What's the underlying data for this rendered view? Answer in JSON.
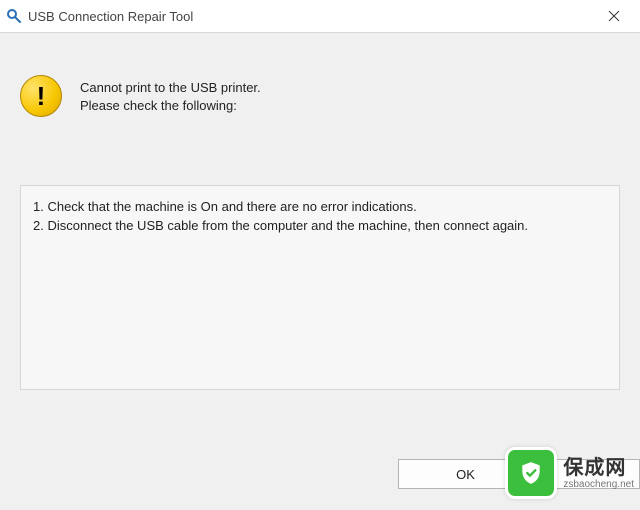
{
  "window": {
    "title": "USB Connection Repair Tool"
  },
  "message": {
    "line1": "Cannot print to the USB printer.",
    "line2": "Please check the following:"
  },
  "steps": {
    "item1": "1. Check that the machine is On and there are no error indications.",
    "item2": "2. Disconnect the USB cable from the computer and the machine, then connect again."
  },
  "buttons": {
    "ok": "OK"
  },
  "watermark": {
    "brand_cn": "保成网",
    "domain": "zsbaocheng.net"
  }
}
